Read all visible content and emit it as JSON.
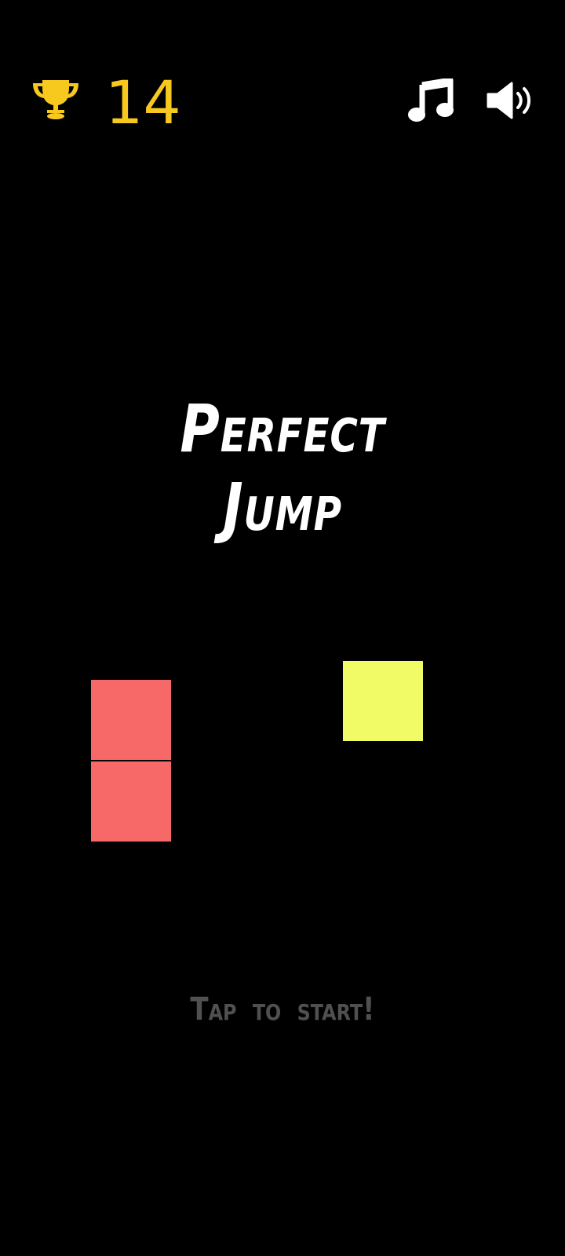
{
  "hud": {
    "best_score": "14",
    "trophy_icon": "trophy-icon",
    "music_icon": "music-note-icon",
    "sound_icon": "speaker-volume-icon",
    "score_color": "#f7c81e"
  },
  "title": {
    "line1": "Perfect",
    "line2": "Jump"
  },
  "game": {
    "player_blocks_color": "#f76868",
    "target_block_color": "#f0fb66"
  },
  "prompt": {
    "text": "Tap to start!"
  }
}
